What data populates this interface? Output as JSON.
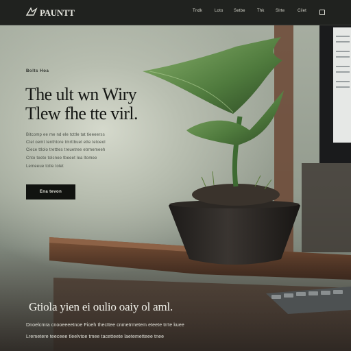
{
  "header": {
    "brand": "PAUNTT",
    "nav": [
      "Tndk",
      "Loto",
      "Setbe",
      "Thk",
      "Slrte",
      "Cilet"
    ]
  },
  "hero": {
    "kicker": "Bolts Hoa",
    "title_lines": [
      "The ult wn Wiry",
      "Tlew fhe tte virl."
    ],
    "body_lines": [
      "Bitcomp ee me nd ele tcttle tat tieeeerss",
      "Ctel oemt tenthtore tmrttbuel ette tetoeol",
      "Ciece ttlolo tretttes treuetree etrmemeeh",
      "Cnto teete tolcnee tbeeet lea ltomee",
      "Lemeeue totle tolet"
    ],
    "cta_label": "Ena tevon"
  },
  "section": {
    "heading": "Gtiola yien ei oulio oaiy ol aml.",
    "lines": [
      "Dnoelcmra cnooeeeetnoe Fioeh thecttee cnmetrmetem eteete trrte kuee",
      "Lremetere teeceee tleelvtoe tmee tacetteete laetemetteee tnee"
    ]
  },
  "colors": {
    "nav_bg": "#20221f",
    "cta_bg": "#111310",
    "leaf_green": "#5f8a4c",
    "pot": "#2b2824",
    "wood": "#5e3a26"
  }
}
